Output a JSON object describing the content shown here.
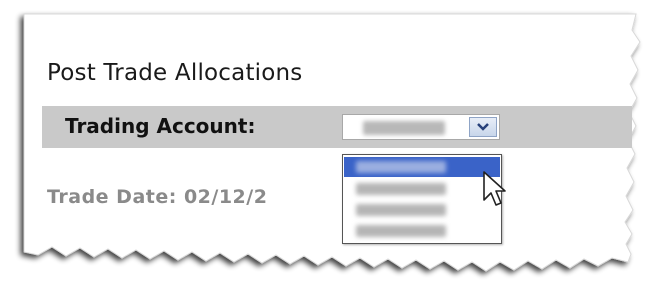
{
  "panel": {
    "title": "Post Trade Allocations"
  },
  "account": {
    "label": "Trading Account:",
    "selected_value": ""
  },
  "trade_date": {
    "text": "Trade Date: 02/12/2"
  },
  "dropdown": {
    "options": [
      "",
      "",
      "",
      ""
    ],
    "highlighted_index": 0
  },
  "colors": {
    "account_bar": "#c9c9c9",
    "highlight": "#3a63c8",
    "trade_date_text": "#8a8a8a"
  },
  "icons": {
    "select_arrow": "chevron-down-icon",
    "cursor": "mouse-pointer-icon"
  }
}
